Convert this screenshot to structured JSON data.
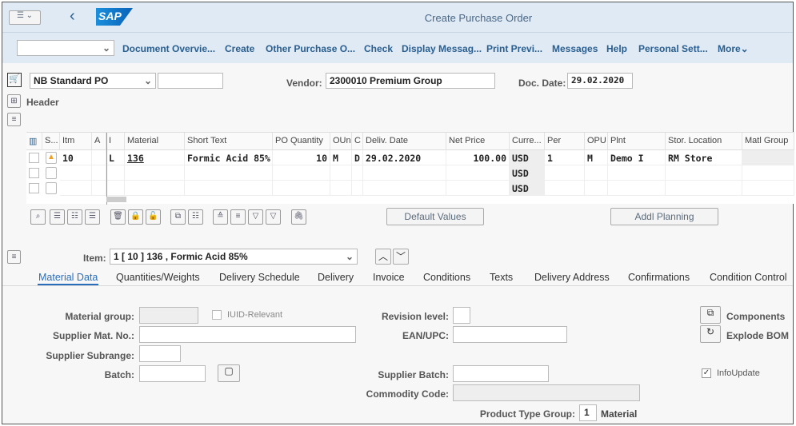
{
  "window": {
    "title": "Create Purchase Order",
    "logo": "SAP"
  },
  "toolbar": {
    "items": [
      "Document Overvie...",
      "Create",
      "Other Purchase O...",
      "Check",
      "Display Messag...",
      "Print Previ...",
      "Messages",
      "Help",
      "Personal Sett...",
      "More"
    ]
  },
  "header": {
    "doc_type": "NB Standard PO",
    "vendor_label": "Vendor:",
    "vendor": "2300010 Premium Group",
    "doc_date_label": "Doc. Date:",
    "doc_date": "29.02.2020",
    "section": "Header"
  },
  "grid": {
    "columns": [
      "S...",
      "Itm",
      "A",
      "I",
      "Material",
      "Short Text",
      "PO Quantity",
      "OUn",
      "C",
      "Deliv. Date",
      "Net Price",
      "Curre...",
      "Per",
      "OPU",
      "Plnt",
      "Stor. Location",
      "Matl Group"
    ],
    "rows": [
      {
        "itm": "10",
        "i": "L",
        "material": "136",
        "short_text": "Formic Acid 85%",
        "qty": "10",
        "oun": "M",
        "c": "D",
        "date": "29.02.2020",
        "price": "100.00",
        "curr": "USD",
        "per": "1",
        "opu": "M",
        "plnt": "Demo I",
        "stor": "RM Store"
      },
      {
        "curr": "USD"
      },
      {
        "curr": "USD"
      }
    ],
    "default_values": "Default Values",
    "addl_planning": "Addl Planning"
  },
  "item": {
    "label": "Item:",
    "value": "1 [ 10 ] 136 , Formic Acid 85%"
  },
  "tabs": [
    "Material Data",
    "Quantities/Weights",
    "Delivery Schedule",
    "Delivery",
    "Invoice",
    "Conditions",
    "Texts",
    "Delivery Address",
    "Confirmations",
    "Condition Control"
  ],
  "material_data": {
    "material_group": "Material group:",
    "iuid": "IUID-Relevant",
    "revision": "Revision level:",
    "components": "Components",
    "supplier_mat": "Supplier Mat. No.:",
    "ean": "EAN/UPC:",
    "explode": "Explode BOM",
    "subrange": "Supplier Subrange:",
    "batch": "Batch:",
    "supplier_batch": "Supplier Batch:",
    "info_update": "InfoUpdate",
    "commodity": "Commodity Code:",
    "ptg_label": "Product Type Group:",
    "ptg_value": "1",
    "ptg_text": "Material"
  },
  "colors": {
    "titlebar": "#dfeaf5",
    "link": "#2a5e8e",
    "warning": "#f0a020"
  }
}
